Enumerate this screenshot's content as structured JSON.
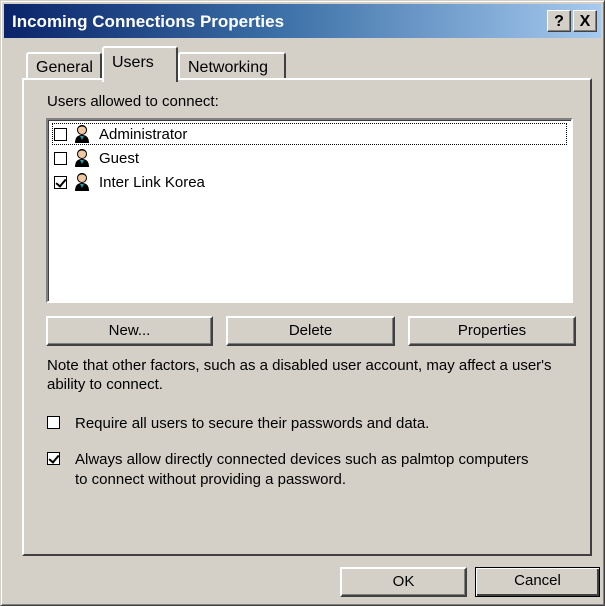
{
  "window": {
    "title": "Incoming Connections Properties",
    "help_button": "?",
    "close_button": "X"
  },
  "tabs": [
    {
      "label": "General",
      "active": false
    },
    {
      "label": "Users",
      "active": true
    },
    {
      "label": "Networking",
      "active": false
    }
  ],
  "users_section": {
    "label": "Users allowed to connect:",
    "users": [
      {
        "name": "Administrator",
        "checked": false,
        "icon": "user-icon"
      },
      {
        "name": "Guest",
        "checked": false,
        "icon": "user-icon"
      },
      {
        "name": "Inter Link Korea",
        "checked": true,
        "icon": "user-icon"
      }
    ]
  },
  "user_buttons": {
    "new": "New...",
    "delete": "Delete",
    "properties": "Properties"
  },
  "note": "Note that other factors, such as a disabled user account, may affect a user's ability to connect.",
  "options": {
    "require_secure": {
      "label": "Require all users to secure their passwords and data.",
      "checked": false
    },
    "always_allow": {
      "label": "Always allow directly connected devices such as palmtop computers to connect without providing a password.",
      "checked": true
    }
  },
  "dialog_buttons": {
    "ok": "OK",
    "cancel": "Cancel"
  },
  "colors": {
    "face": "#d4d0c8",
    "title_start": "#0a246a",
    "title_end": "#a6caf0"
  }
}
